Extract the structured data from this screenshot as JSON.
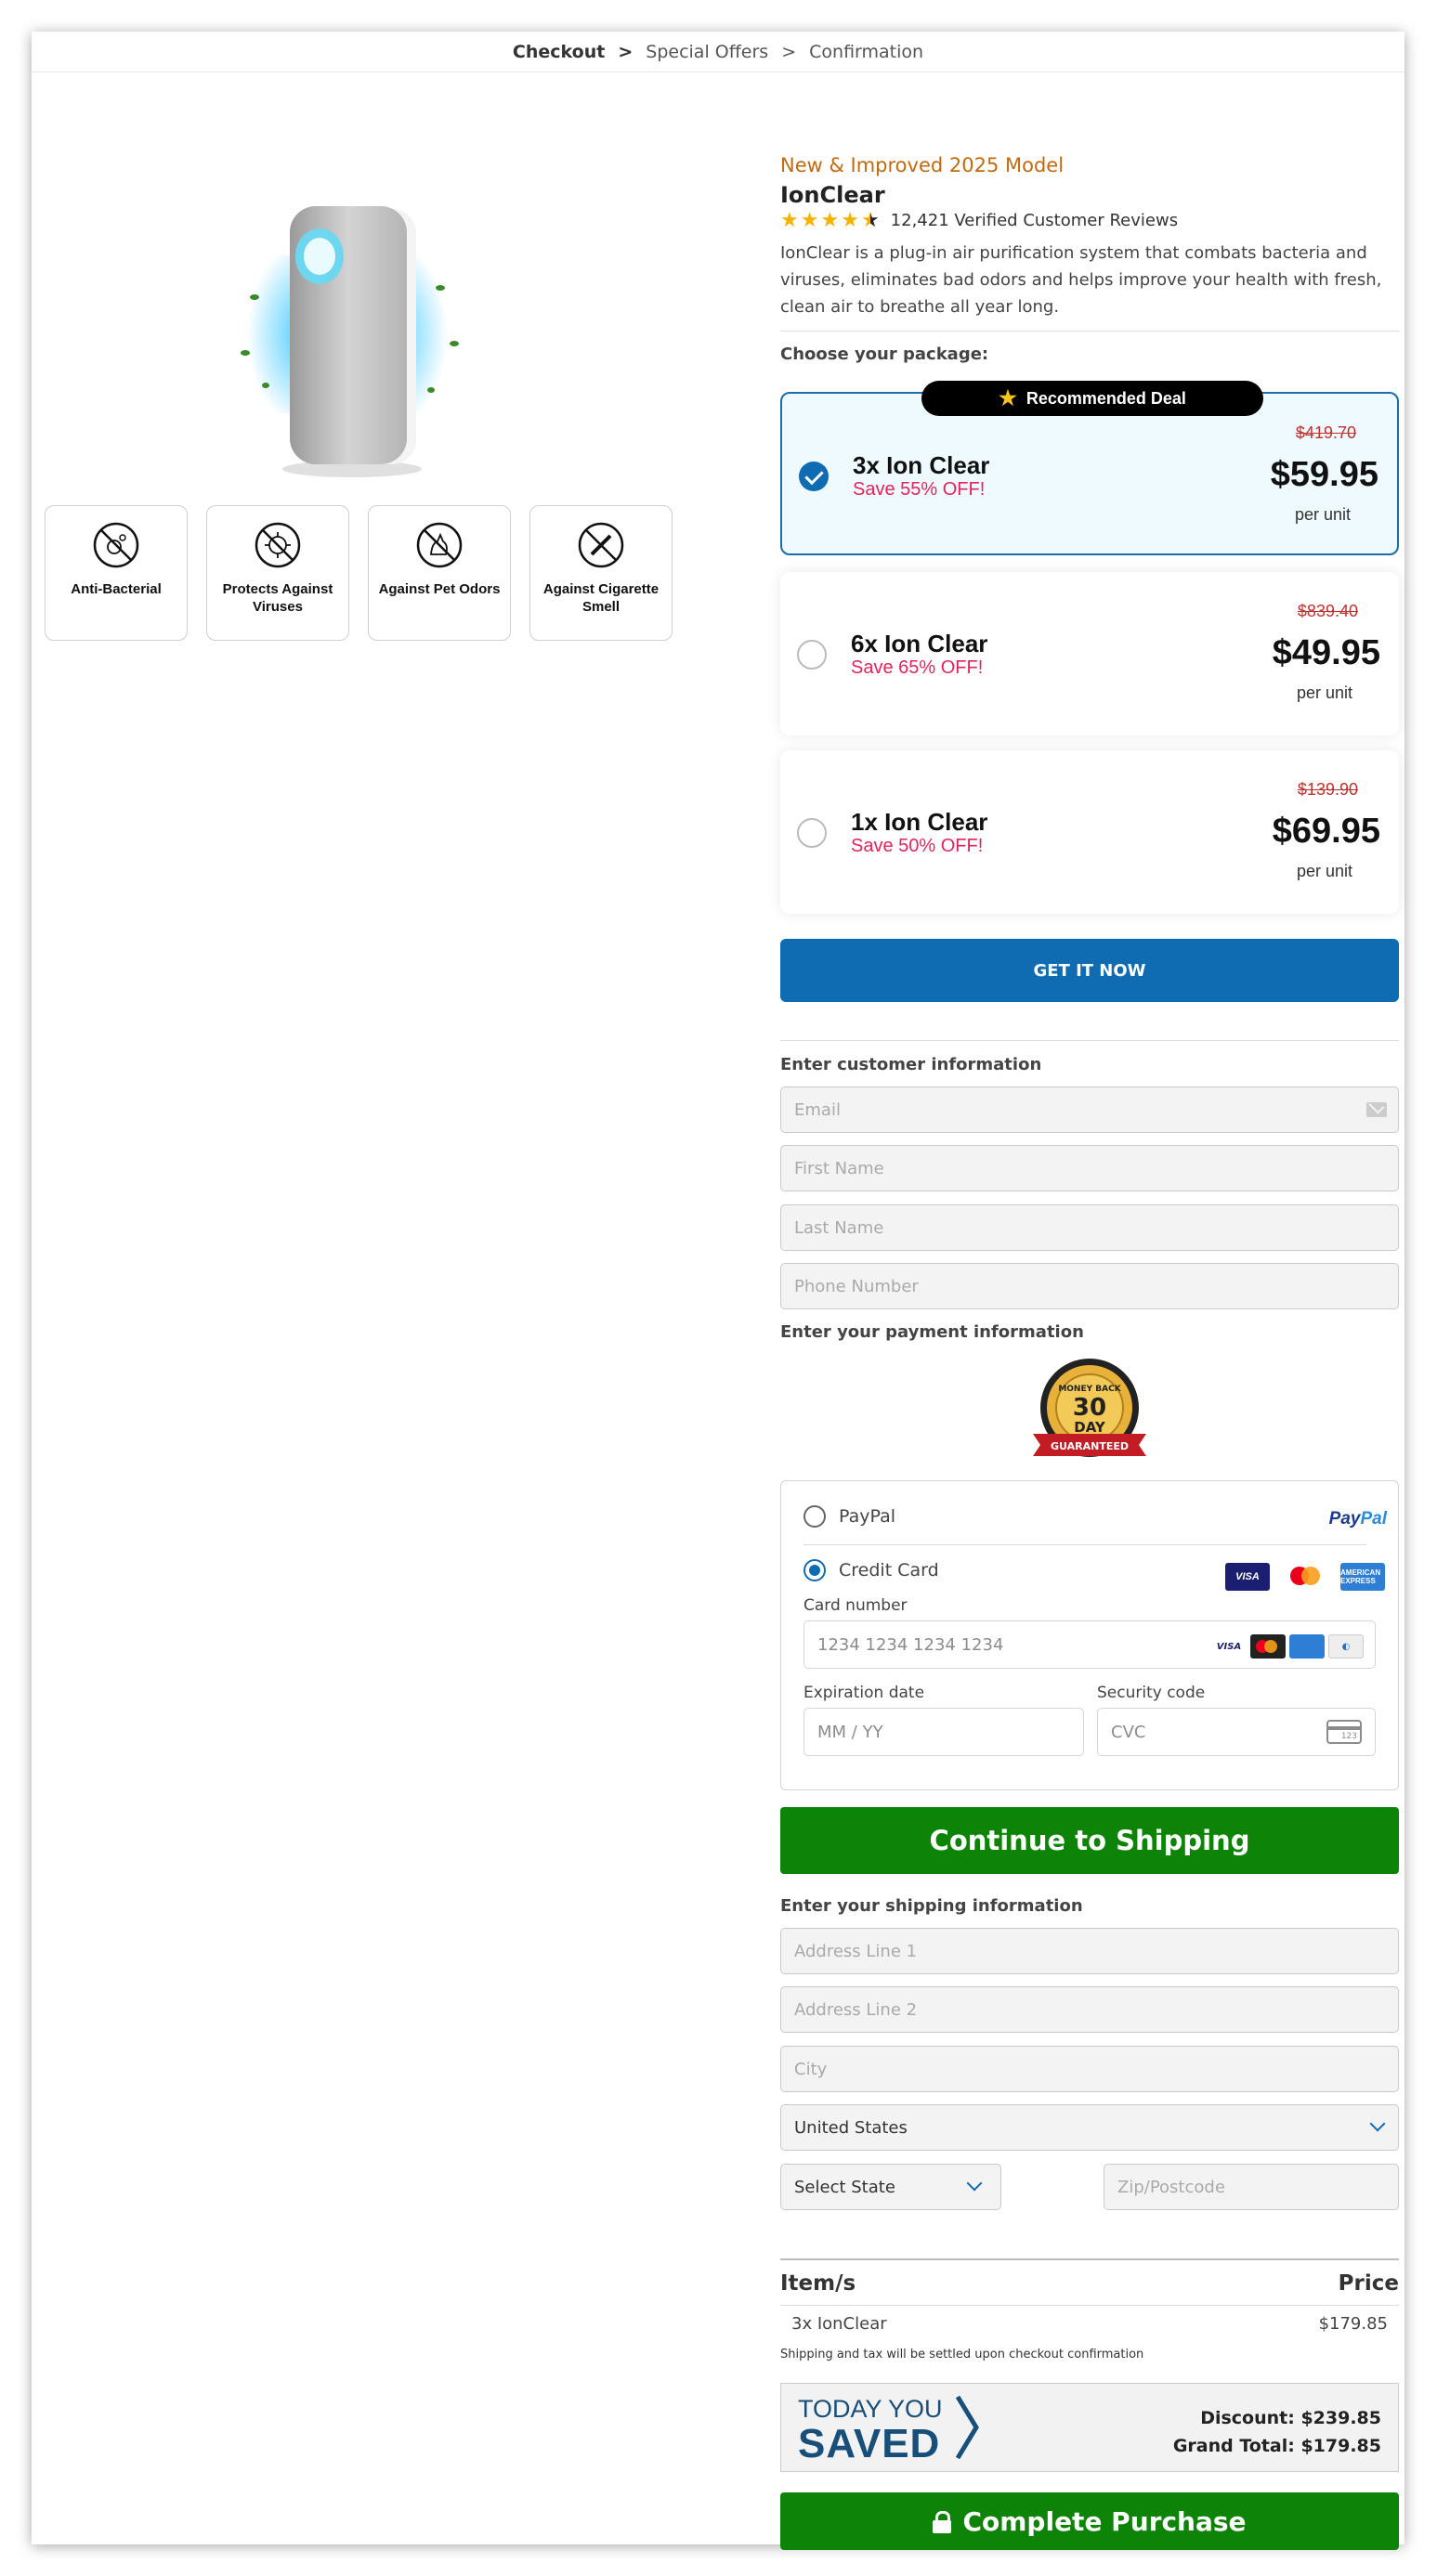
{
  "breadcrumb": {
    "step1": "Checkout",
    "sep1": ">",
    "step2": "Special Offers",
    "sep2": ">",
    "step3": "Confirmation"
  },
  "product": {
    "kicker": "New & Improved 2025 Model",
    "name": "IonClear",
    "rating_stars": 4.5,
    "reviews": "12,421 Verified Customer Reviews",
    "description": "IonClear is a plug-in air purification system that combats bacteria and viruses, eliminates bad odors and helps improve your health with fresh, clean air to breathe all year long."
  },
  "badges": [
    {
      "label": "Anti-Bacterial",
      "icon": "bacteria-icon"
    },
    {
      "label": "Protects Against Viruses",
      "icon": "virus-icon"
    },
    {
      "label": "Against Pet Odors",
      "icon": "pet-icon"
    },
    {
      "label": "Against Cigarette Smell",
      "icon": "cigarette-icon"
    }
  ],
  "packages": {
    "label": "Choose your package:",
    "ribbon": "Recommended Deal",
    "items": [
      {
        "name": "3x Ion Clear",
        "save": "Save 55% OFF!",
        "old_price": "$419.70",
        "price": "$59.95",
        "unit": "per unit",
        "selected": true
      },
      {
        "name": "6x Ion Clear",
        "save": "Save 65% OFF!",
        "old_price": "$839.40",
        "price": "$49.95",
        "unit": "per unit",
        "selected": false
      },
      {
        "name": "1x Ion Clear",
        "save": "Save 50% OFF!",
        "old_price": "$139.90",
        "price": "$69.95",
        "unit": "per unit",
        "selected": false
      }
    ]
  },
  "cta": {
    "get_it_now": "GET IT NOW"
  },
  "customer": {
    "label": "Enter customer information",
    "email_placeholder": "Email",
    "first_name_placeholder": "First Name",
    "last_name_placeholder": "Last Name",
    "phone_placeholder": "Phone Number"
  },
  "payment": {
    "label": "Enter your payment information",
    "seal_text": {
      "top": "MONEY BACK",
      "number": "30",
      "day": "DAY",
      "ribbon": "GUARANTEED"
    },
    "paypal_label": "PayPal",
    "paypal_logo_a": "Pay",
    "paypal_logo_b": "Pal",
    "credit_label": "Credit Card",
    "card_number_label": "Card number",
    "card_number_placeholder": "1234 1234 1234 1234",
    "expiry_label": "Expiration date",
    "expiry_placeholder": "MM / YY",
    "cvc_label": "Security code",
    "cvc_placeholder": "CVC",
    "visa": "VISA",
    "amex": "AMERICAN EXPRESS",
    "cvc_icon_text": "123"
  },
  "continue_button": "Continue to Shipping",
  "shipping": {
    "label": "Enter your shipping information",
    "address1_placeholder": "Address Line 1",
    "address2_placeholder": "Address Line 2",
    "city_placeholder": "City",
    "country": "United States",
    "state": "Select State",
    "zip_placeholder": "Zip/Postcode"
  },
  "summary": {
    "item_header": "Item/s",
    "price_header": "Price",
    "item": "3x IonClear",
    "item_price": "$179.85",
    "note": "Shipping and tax will be settled upon checkout confirmation",
    "today_you": "TODAY YOU",
    "saved": "SAVED",
    "discount": "Discount: $239.85",
    "grand_total": "Grand Total: $179.85"
  },
  "complete_button": "Complete Purchase",
  "colors": {
    "primary_blue": "#0f6cb3",
    "green": "#0d8408",
    "sale_red": "#e2245b",
    "kicker_orange": "#c36a10"
  }
}
